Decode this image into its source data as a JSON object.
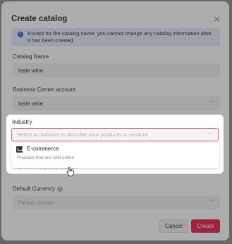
{
  "modal": {
    "title": "Create catalog",
    "info_text": "Except for the catalog name, you cannot change any catalog information after it has been created."
  },
  "catalog_name": {
    "label": "Catalog Name",
    "value": "taste wine"
  },
  "business_center": {
    "label": "Business Center account",
    "value": "taste wine"
  },
  "industry": {
    "label": "Industry",
    "placeholder": "Select an industry to describe your products or services",
    "options": [
      {
        "title": "E-commerce",
        "description": "Products that are sold online",
        "icon": "cart-icon"
      }
    ]
  },
  "targeting_location": {
    "placeholder": "Select a targeting location"
  },
  "default_currency": {
    "label": "Default Currency",
    "placeholder": "Please choose"
  },
  "footer": {
    "cancel_label": "Cancel",
    "create_label": "Create"
  },
  "colors": {
    "brand_primary": "#e8214c",
    "info_blue": "#2f5fd0",
    "focus_border": "#e05a73"
  }
}
